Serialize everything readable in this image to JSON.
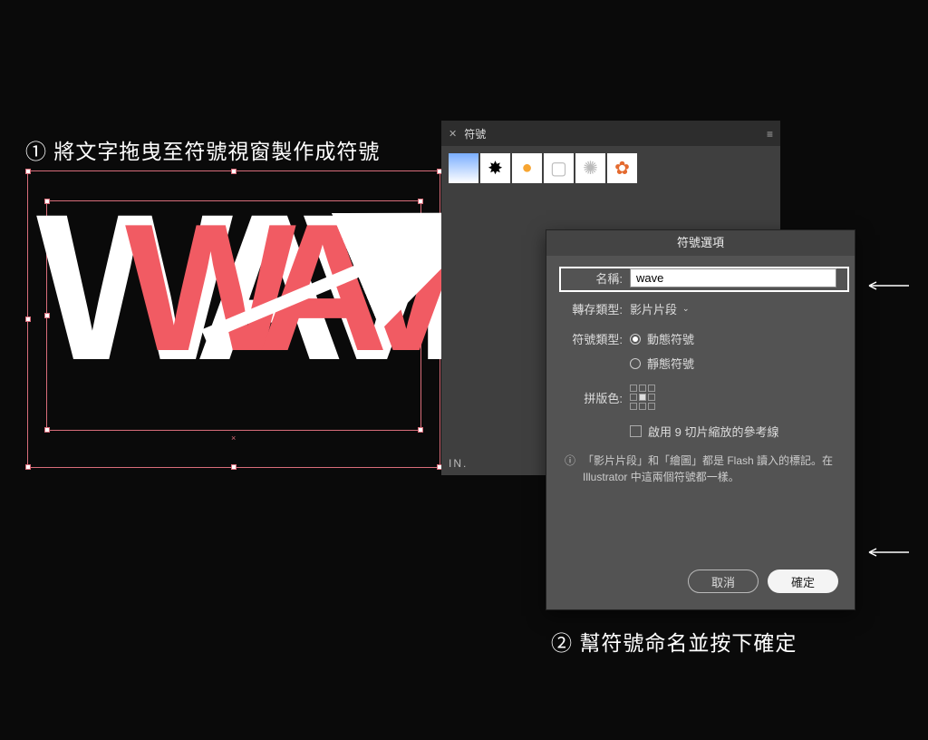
{
  "annotations": {
    "step1": "① 將文字拖曳至符號視窗製作成符號",
    "step2": "② 幫符號命名並按下確定"
  },
  "artwork": {
    "text_back": "WAVE",
    "text_front": "WAVE"
  },
  "symbols_panel": {
    "title": "符號",
    "footer": "IN."
  },
  "dialog": {
    "title": "符號選項",
    "name_label": "名稱:",
    "name_value": "wave",
    "export_type_label": "轉存類型:",
    "export_type_value": "影片片段",
    "symbol_type_label": "符號類型:",
    "symbol_type_options": {
      "dynamic": "動態符號",
      "static": "靜態符號"
    },
    "registration_label": "拼版色:",
    "nine_slice_label": "啟用 9 切片縮放的參考線",
    "info_text": "「影片片段」和「繪圖」都是 Flash 讀入的標記。在 Illustrator 中這兩個符號都一樣。",
    "cancel": "取消",
    "ok": "確定"
  }
}
